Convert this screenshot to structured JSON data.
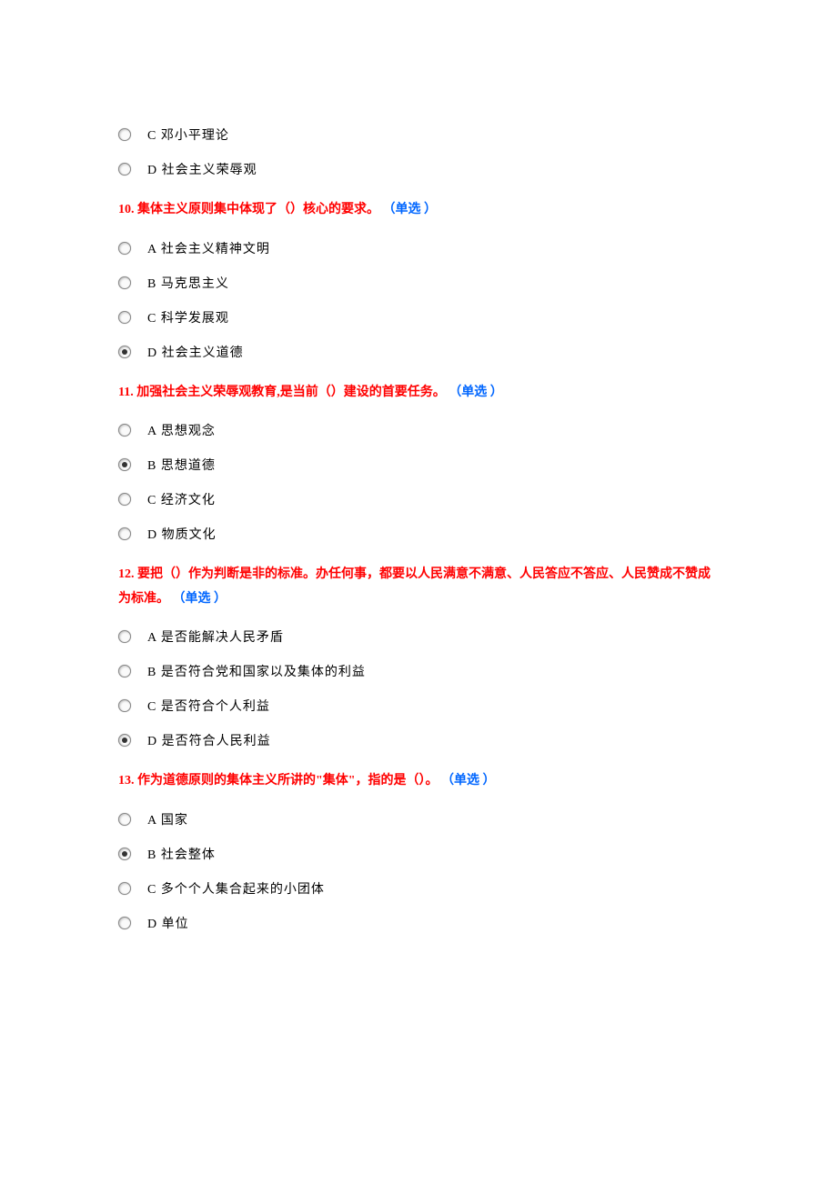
{
  "orphan_options": [
    {
      "letter": "C",
      "text": "邓小平理论",
      "selected": false
    },
    {
      "letter": "D",
      "text": "社会主义荣辱观",
      "selected": false
    }
  ],
  "questions": [
    {
      "number": "10.",
      "text": "集体主义原则集中体现了（）核心的要求。",
      "type": "（单选 ）",
      "options": [
        {
          "letter": "A",
          "text": "社会主义精神文明",
          "selected": false
        },
        {
          "letter": "B",
          "text": "马克思主义",
          "selected": false
        },
        {
          "letter": "C",
          "text": "科学发展观",
          "selected": false
        },
        {
          "letter": "D",
          "text": "社会主义道德",
          "selected": true
        }
      ]
    },
    {
      "number": "11.",
      "text": "加强社会主义荣辱观教育,是当前（）建设的首要任务。",
      "type": "（单选 ）",
      "options": [
        {
          "letter": "A",
          "text": "思想观念",
          "selected": false
        },
        {
          "letter": "B",
          "text": "思想道德",
          "selected": true
        },
        {
          "letter": "C",
          "text": "经济文化",
          "selected": false
        },
        {
          "letter": "D",
          "text": "物质文化",
          "selected": false
        }
      ]
    },
    {
      "number": "12.",
      "text": "要把（）作为判断是非的标准。办任何事，都要以人民满意不满意、人民答应不答应、人民赞成不赞成为标准。",
      "type": "（单选 ）",
      "options": [
        {
          "letter": "A",
          "text": "是否能解决人民矛盾",
          "selected": false
        },
        {
          "letter": "B",
          "text": "是否符合党和国家以及集体的利益",
          "selected": false
        },
        {
          "letter": "C",
          "text": "是否符合个人利益",
          "selected": false
        },
        {
          "letter": "D",
          "text": "是否符合人民利益",
          "selected": true
        }
      ]
    },
    {
      "number": "13.",
      "text": "作为道德原则的集体主义所讲的\"集体\"，指的是（）。",
      "type": "（单选 ）",
      "options": [
        {
          "letter": "A",
          "text": "国家",
          "selected": false
        },
        {
          "letter": "B",
          "text": "社会整体",
          "selected": true
        },
        {
          "letter": "C",
          "text": "多个个人集合起来的小团体",
          "selected": false
        },
        {
          "letter": "D",
          "text": "单位",
          "selected": false
        }
      ]
    }
  ]
}
